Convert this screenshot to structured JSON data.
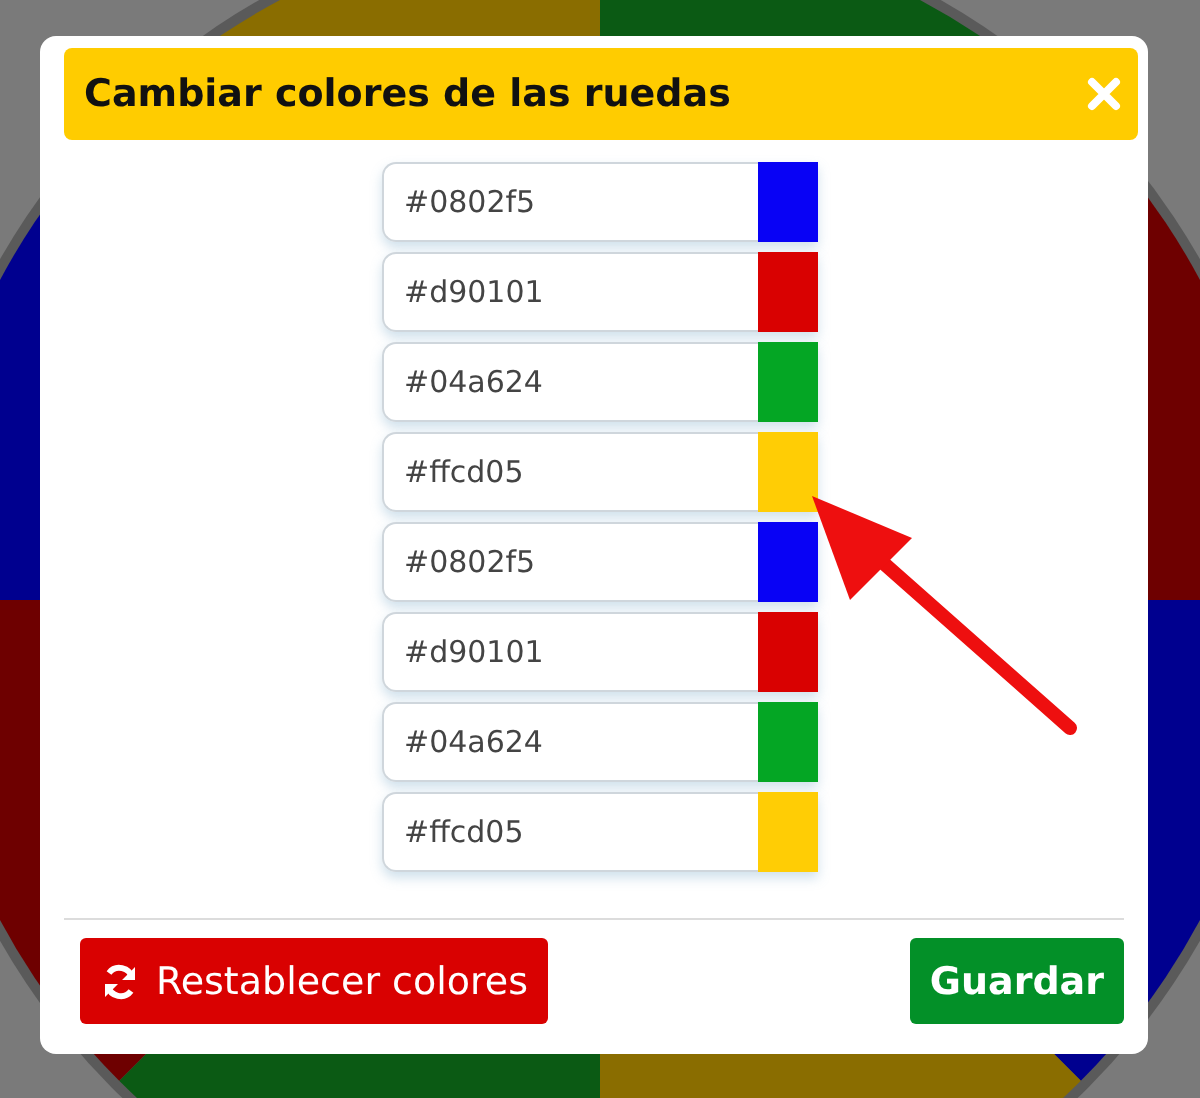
{
  "dialog": {
    "title": "Cambiar colores de las ruedas",
    "colors": [
      {
        "value": "#0802f5",
        "color": "#0802f5"
      },
      {
        "value": "#d90101",
        "color": "#d90101"
      },
      {
        "value": "#04a624",
        "color": "#04a624"
      },
      {
        "value": "#ffcd05",
        "color": "#ffcd05"
      },
      {
        "value": "#0802f5",
        "color": "#0802f5"
      },
      {
        "value": "#d90101",
        "color": "#d90101"
      },
      {
        "value": "#04a624",
        "color": "#04a624"
      },
      {
        "value": "#ffcd05",
        "color": "#ffcd05"
      }
    ],
    "reset_button": "Restablecer colores",
    "save_button": "Guardar"
  }
}
